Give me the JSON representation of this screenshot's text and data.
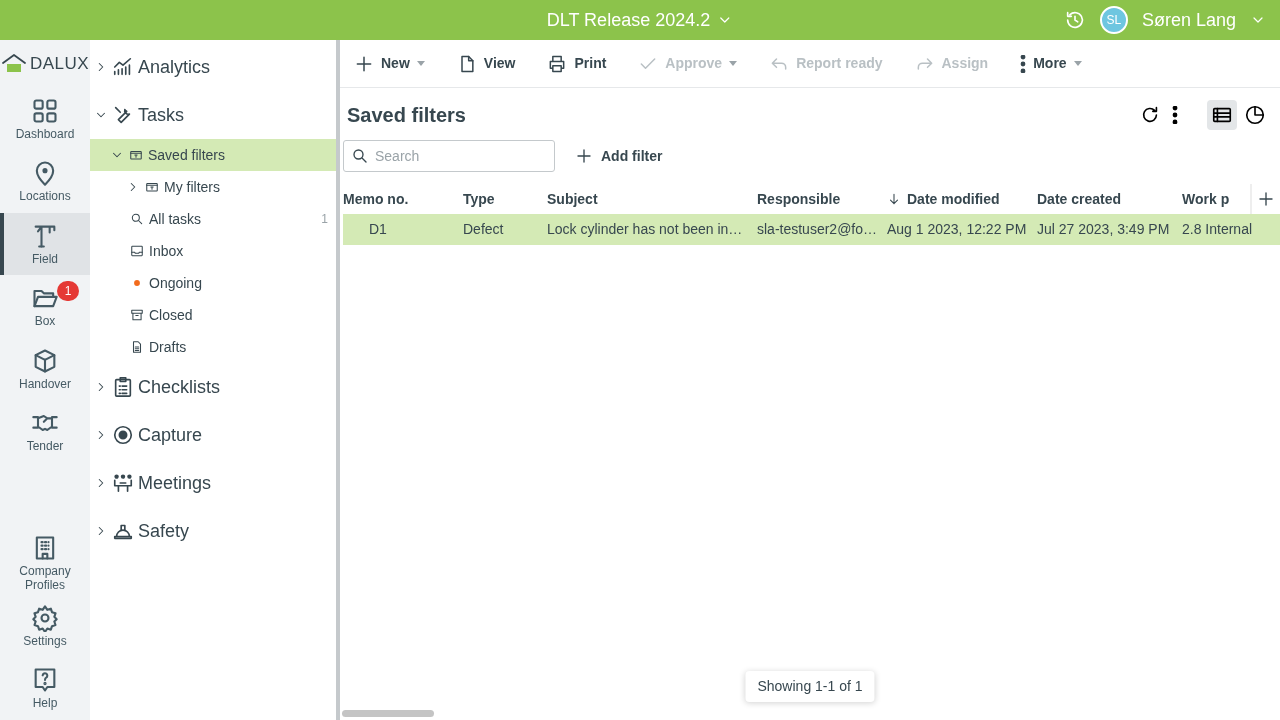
{
  "header": {
    "title": "DLT Release 2024.2",
    "user_initials": "SL",
    "user_name": "Søren Lang"
  },
  "rail": {
    "logo": "DALUX",
    "items": [
      {
        "label": "Dashboard",
        "selected": false
      },
      {
        "label": "Locations",
        "selected": false
      },
      {
        "label": "Field",
        "selected": true
      },
      {
        "label": "Box",
        "selected": false,
        "badge": "1"
      },
      {
        "label": "Handover",
        "selected": false
      },
      {
        "label": "Tender",
        "selected": false
      },
      {
        "label": "Company Profiles",
        "selected": false
      },
      {
        "label": "Settings",
        "selected": false
      },
      {
        "label": "Help",
        "selected": false
      }
    ]
  },
  "nav": {
    "items": [
      {
        "label": "Analytics",
        "expanded": false
      },
      {
        "label": "Tasks",
        "expanded": true,
        "children": [
          {
            "label": "Saved filters",
            "expanded": true,
            "selected": true,
            "children": [
              {
                "label": "My filters",
                "expanded": false,
                "selected": false
              }
            ]
          },
          {
            "label": "All tasks",
            "selected": false,
            "count": "1"
          },
          {
            "label": "Inbox",
            "selected": false
          },
          {
            "label": "Ongoing",
            "selected": false
          },
          {
            "label": "Closed",
            "selected": false
          },
          {
            "label": "Drafts",
            "selected": false
          }
        ]
      },
      {
        "label": "Checklists",
        "expanded": false
      },
      {
        "label": "Capture",
        "expanded": false
      },
      {
        "label": "Meetings",
        "expanded": false
      },
      {
        "label": "Safety",
        "expanded": false
      }
    ]
  },
  "toolbar": [
    {
      "label": "New",
      "disabled": false,
      "dropdown": true
    },
    {
      "label": "View",
      "disabled": false,
      "dropdown": false
    },
    {
      "label": "Print",
      "disabled": false,
      "dropdown": false
    },
    {
      "label": "Approve",
      "disabled": true,
      "dropdown": true
    },
    {
      "label": "Report ready",
      "disabled": true,
      "dropdown": false
    },
    {
      "label": "Assign",
      "disabled": true,
      "dropdown": false
    },
    {
      "label": "More",
      "disabled": false,
      "dropdown": true
    }
  ],
  "page": {
    "title": "Saved filters",
    "views": [
      {
        "selected": true
      },
      {
        "selected": false
      }
    ],
    "search": {
      "placeholder": "Search"
    },
    "add_filter": "Add filter"
  },
  "table": {
    "columns": [
      {
        "label": "Memo no.",
        "sorted": false
      },
      {
        "label": "Type",
        "sorted": false
      },
      {
        "label": "Subject",
        "sorted": false
      },
      {
        "label": "Responsible",
        "sorted": false
      },
      {
        "label": "Date modified",
        "sorted": true
      },
      {
        "label": "Date created",
        "sorted": false
      },
      {
        "label": "Work p",
        "sorted": false
      }
    ],
    "rows": [
      {
        "selected": true,
        "cells": [
          "D1",
          "Defect",
          "Lock cylinder has not been in…",
          "sla-testuser2@fo…",
          "Aug 1 2023, 12:22 PM",
          "Jul 27 2023, 3:49 PM",
          "2.8 Internal"
        ]
      }
    ]
  },
  "footer": {
    "status": "Showing 1-1 of 1"
  }
}
